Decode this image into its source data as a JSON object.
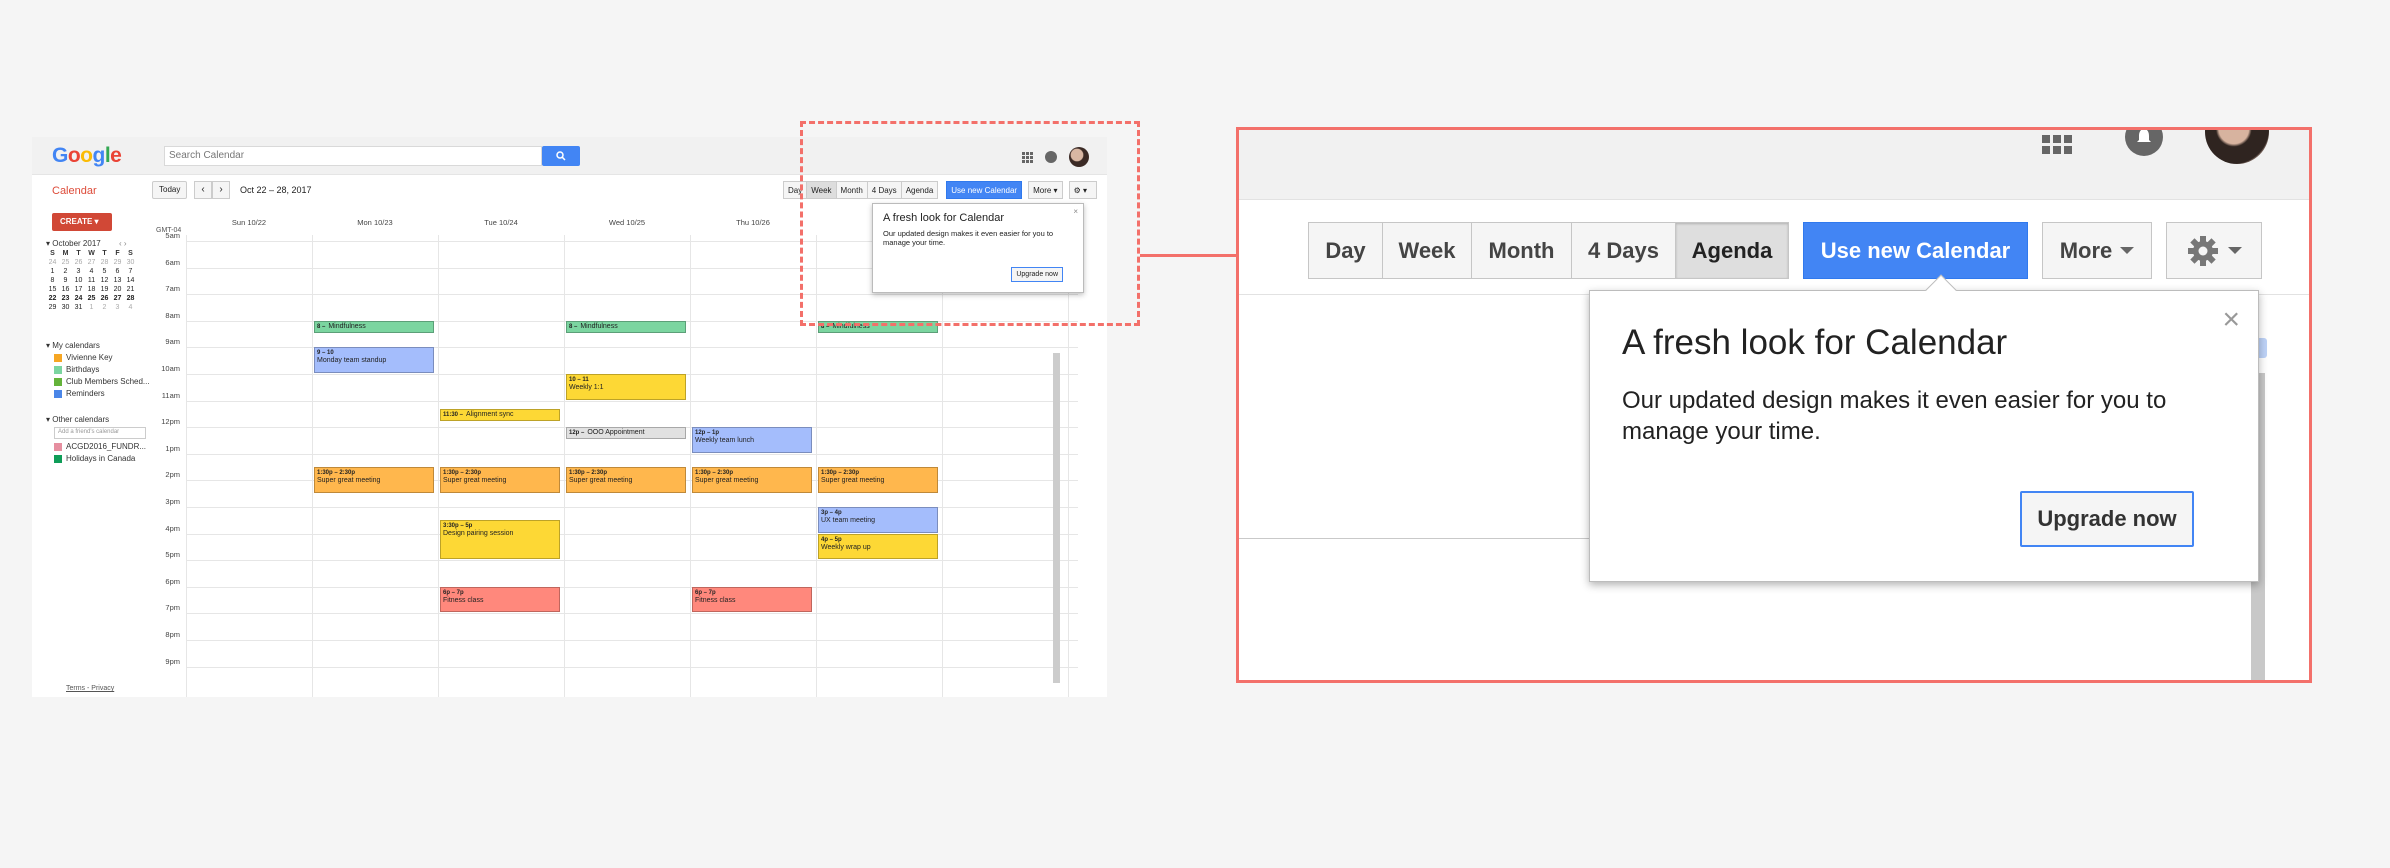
{
  "mini": {
    "logo": [
      "G",
      "o",
      "o",
      "g",
      "l",
      "e"
    ],
    "logo_colors": [
      "#4285f4",
      "#ea4335",
      "#fbbc05",
      "#4285f4",
      "#34a853",
      "#ea4335"
    ],
    "search_placeholder": "Search Calendar",
    "app_title": "Calendar",
    "today": "Today",
    "prev": "‹",
    "next": "›",
    "date_range": "Oct 22 – 28, 2017",
    "views": [
      "Day",
      "Week",
      "Month",
      "4 Days",
      "Agenda"
    ],
    "use_new": "Use new Calendar",
    "more": "More ▾",
    "gear": "⚙ ▾",
    "create": "CREATE",
    "month_title": "October 2017",
    "weekday_letters": [
      "S",
      "M",
      "T",
      "W",
      "T",
      "F",
      "S"
    ],
    "month_days": [
      "24",
      "25",
      "26",
      "27",
      "28",
      "29",
      "30",
      "1",
      "2",
      "3",
      "4",
      "5",
      "6",
      "7",
      "8",
      "9",
      "10",
      "11",
      "12",
      "13",
      "14",
      "15",
      "16",
      "17",
      "18",
      "19",
      "20",
      "21",
      "22",
      "23",
      "24",
      "25",
      "26",
      "27",
      "28",
      "29",
      "30",
      "31",
      "1",
      "2",
      "3",
      "4"
    ],
    "my_calendars_title": "My calendars",
    "my_calendars": [
      {
        "label": "Vivienne Key",
        "color": "#f6a623"
      },
      {
        "label": "Birthdays",
        "color": "#7bd5a0"
      },
      {
        "label": "Club Members Sched...",
        "color": "#64b33a"
      },
      {
        "label": "Reminders",
        "color": "#4a86e8"
      }
    ],
    "other_calendars_title": "Other calendars",
    "friend_placeholder": "Add a friend's calendar",
    "other_calendars": [
      {
        "label": "ACGD2016_FUNDR...",
        "color": "#e68fa0"
      },
      {
        "label": "Holidays in Canada",
        "color": "#0f9d58"
      }
    ],
    "terms": "Terms - Privacy",
    "timezone": "GMT-04",
    "days": [
      "Sun 10/22",
      "Mon 10/23",
      "Tue 10/24",
      "Wed 10/25",
      "Thu 10/26"
    ],
    "hours": [
      "5am",
      "6am",
      "7am",
      "8am",
      "9am",
      "10am",
      "11am",
      "12pm",
      "1pm",
      "2pm",
      "3pm",
      "4pm",
      "5pm",
      "6pm",
      "7pm",
      "8pm",
      "9pm"
    ],
    "events": [
      {
        "day": 1,
        "start": 8.0,
        "end": 8.5,
        "time": "8 –",
        "title": "Mindfulness",
        "color": "#7bd5a0"
      },
      {
        "day": 3,
        "start": 8.0,
        "end": 8.5,
        "time": "8 –",
        "title": "Mindfulness",
        "color": "#7bd5a0"
      },
      {
        "day": 5,
        "start": 8.0,
        "end": 8.5,
        "time": "8 –",
        "title": "Mindfulness",
        "color": "#7bd5a0"
      },
      {
        "day": 1,
        "start": 9.0,
        "end": 10.0,
        "time": "9 – 10",
        "title": "Monday team standup",
        "color": "#a4bdfc"
      },
      {
        "day": 3,
        "start": 10.0,
        "end": 11.0,
        "time": "10 – 11",
        "title": "Weekly 1:1",
        "color": "#fdd835"
      },
      {
        "day": 2,
        "start": 11.3,
        "end": 11.8,
        "time": "11:30 –",
        "title": "Alignment sync",
        "color": "#fdd835"
      },
      {
        "day": 3,
        "start": 12.0,
        "end": 12.5,
        "time": "12p –",
        "title": "OOO Appointment",
        "color": "#e1e1e1"
      },
      {
        "day": 4,
        "start": 12.0,
        "end": 13.0,
        "time": "12p – 1p",
        "title": "Weekly team lunch",
        "color": "#a4bdfc"
      },
      {
        "day": 1,
        "start": 13.5,
        "end": 14.5,
        "time": "1:30p – 2:30p",
        "title": "Super great meeting",
        "color": "#ffb74d"
      },
      {
        "day": 2,
        "start": 13.5,
        "end": 14.5,
        "time": "1:30p – 2:30p",
        "title": "Super great meeting",
        "color": "#ffb74d"
      },
      {
        "day": 3,
        "start": 13.5,
        "end": 14.5,
        "time": "1:30p – 2:30p",
        "title": "Super great meeting",
        "color": "#ffb74d"
      },
      {
        "day": 4,
        "start": 13.5,
        "end": 14.5,
        "time": "1:30p – 2:30p",
        "title": "Super great meeting",
        "color": "#ffb74d"
      },
      {
        "day": 5,
        "start": 13.5,
        "end": 14.5,
        "time": "1:30p – 2:30p",
        "title": "Super great meeting",
        "color": "#ffb74d"
      },
      {
        "day": 2,
        "start": 15.5,
        "end": 17.0,
        "time": "3:30p – 5p",
        "title": "Design pairing session",
        "color": "#fdd835"
      },
      {
        "day": 5,
        "start": 15.0,
        "end": 16.0,
        "time": "3p – 4p",
        "title": "UX team meeting",
        "color": "#a4bdfc"
      },
      {
        "day": 5,
        "start": 16.0,
        "end": 17.0,
        "time": "4p – 5p",
        "title": "Weekly wrap up",
        "color": "#fdd835"
      },
      {
        "day": 2,
        "start": 18.0,
        "end": 19.0,
        "time": "6p – 7p",
        "title": "Fitness class",
        "color": "#ff887c"
      },
      {
        "day": 4,
        "start": 18.0,
        "end": 19.0,
        "time": "6p – 7p",
        "title": "Fitness class",
        "color": "#ff887c"
      }
    ],
    "popup": {
      "title": "A fresh look for Calendar",
      "body": "Our updated design makes it even easier for you to manage your time.",
      "button": "Upgrade now",
      "close": "×"
    }
  },
  "zoom": {
    "views": [
      "Day",
      "Week",
      "Month",
      "4 Days",
      "Agenda"
    ],
    "active_view": "Agenda",
    "use_new": "Use new Calendar",
    "more": "More",
    "popup": {
      "title": "A fresh look for Calendar",
      "body": "Our updated design makes it even easier for you to manage your time.",
      "button": "Upgrade now",
      "close": "×"
    }
  },
  "colors": {
    "accent_blue": "#4285f4",
    "highlight_red": "#f3706a",
    "create_red": "#d14836"
  }
}
